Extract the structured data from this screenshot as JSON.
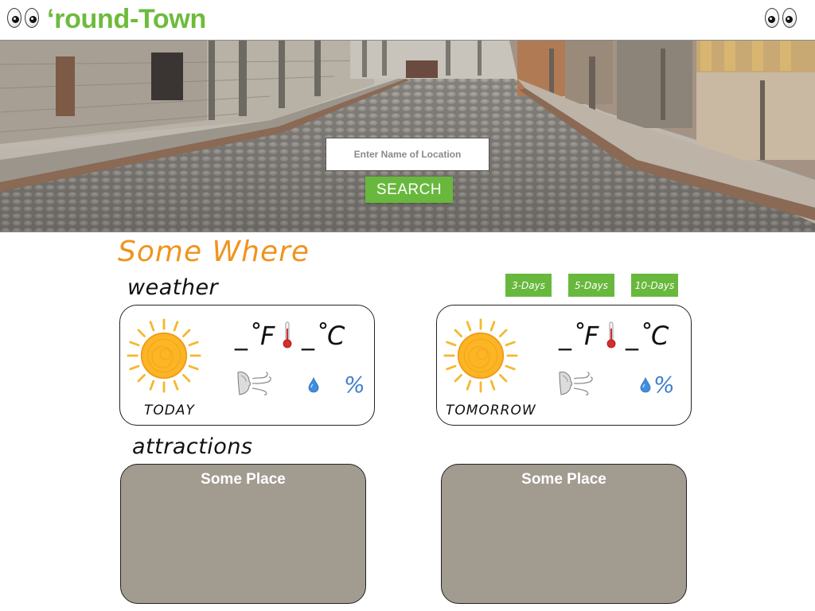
{
  "header": {
    "app_title": "‘round-Town",
    "brand_color": "#6dbb3c",
    "logo_icon": "eyes-icon"
  },
  "search": {
    "placeholder": "Enter Name of Location",
    "value": "",
    "button_label": "SEARCH",
    "hero_image": "cobblestone-street-photo"
  },
  "location": {
    "name": "Some Where",
    "color": "#f0941e"
  },
  "weather": {
    "heading": "weather",
    "forecast_buttons": [
      {
        "label": "3-Days"
      },
      {
        "label": "5-Days"
      },
      {
        "label": "10-Days"
      }
    ],
    "accent_color": "#68b83d",
    "cards": [
      {
        "day": "TODAY",
        "condition_icon": "sun-icon",
        "temp_f": "_˚F",
        "temp_c": "_˚C",
        "thermometer_icon": "thermometer-icon",
        "wind_icon": "wind-icon",
        "humidity_icon": "water-drop-icon",
        "humidity": "%"
      },
      {
        "day": "TOMORROW",
        "condition_icon": "sun-icon",
        "temp_f": "_˚F",
        "temp_c": "_˚C",
        "thermometer_icon": "thermometer-icon",
        "wind_icon": "wind-icon",
        "humidity_icon": "water-drop-icon",
        "humidity": "%"
      }
    ]
  },
  "attractions": {
    "heading": "attractions",
    "card_color": "#a29b90",
    "items": [
      {
        "title": "Some Place"
      },
      {
        "title": "Some Place"
      }
    ]
  }
}
